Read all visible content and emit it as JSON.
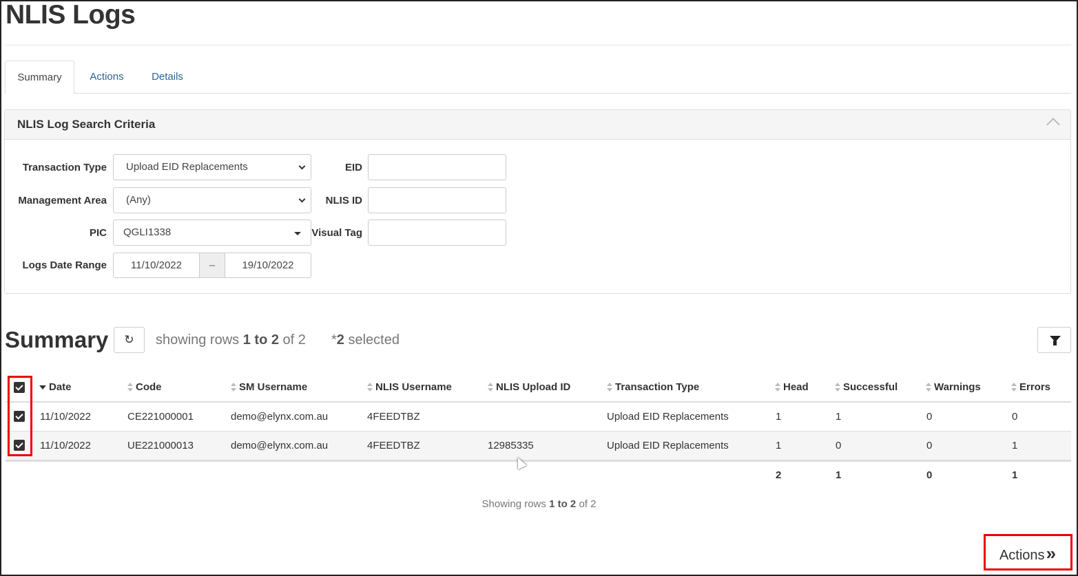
{
  "page": {
    "title": "NLIS Logs"
  },
  "tabs": [
    {
      "label": "Summary",
      "active": true
    },
    {
      "label": "Actions",
      "active": false
    },
    {
      "label": "Details",
      "active": false
    }
  ],
  "criteria": {
    "title": "NLIS Log Search Criteria",
    "transaction_type": {
      "label": "Transaction Type",
      "value": "Upload EID Replacements"
    },
    "management_area": {
      "label": "Management Area",
      "value": "(Any)"
    },
    "pic": {
      "label": "PIC",
      "value": "QGLI1338"
    },
    "date_range": {
      "label": "Logs Date Range",
      "from": "11/10/2022",
      "separator": "–",
      "to": "19/10/2022"
    },
    "eid": {
      "label": "EID",
      "value": ""
    },
    "nlis_id": {
      "label": "NLIS ID",
      "value": ""
    },
    "visual_tag": {
      "label": "Visual Tag",
      "value": ""
    }
  },
  "summary": {
    "title": "Summary",
    "info_prefix": "showing rows",
    "info_range": "1 to 2",
    "info_suffix": "of 2",
    "selected_prefix": "*",
    "selected_count": "2",
    "selected_suffix": "selected"
  },
  "table": {
    "columns": [
      "Date",
      "Code",
      "SM Username",
      "NLIS Username",
      "NLIS Upload ID",
      "Transaction Type",
      "Head",
      "Successful",
      "Warnings",
      "Errors"
    ],
    "rows": [
      [
        "11/10/2022",
        "CE221000001",
        "demo@elynx.com.au",
        "4FEEDTBZ",
        "",
        "Upload EID Replacements",
        "1",
        "1",
        "0",
        "0"
      ],
      [
        "11/10/2022",
        "UE221000013",
        "demo@elynx.com.au",
        "4FEEDTBZ",
        "12985335",
        "Upload EID Replacements",
        "1",
        "0",
        "0",
        "1"
      ]
    ],
    "totals": {
      "head": "2",
      "successful": "1",
      "warnings": "0",
      "errors": "1"
    }
  },
  "pager": {
    "prefix": "Showing rows",
    "range": "1 to 2",
    "suffix": "of 2"
  },
  "actions_button": {
    "label": "Actions",
    "icon": "»"
  },
  "colors": {
    "highlight": "#e00000",
    "link": "#2a6496"
  }
}
